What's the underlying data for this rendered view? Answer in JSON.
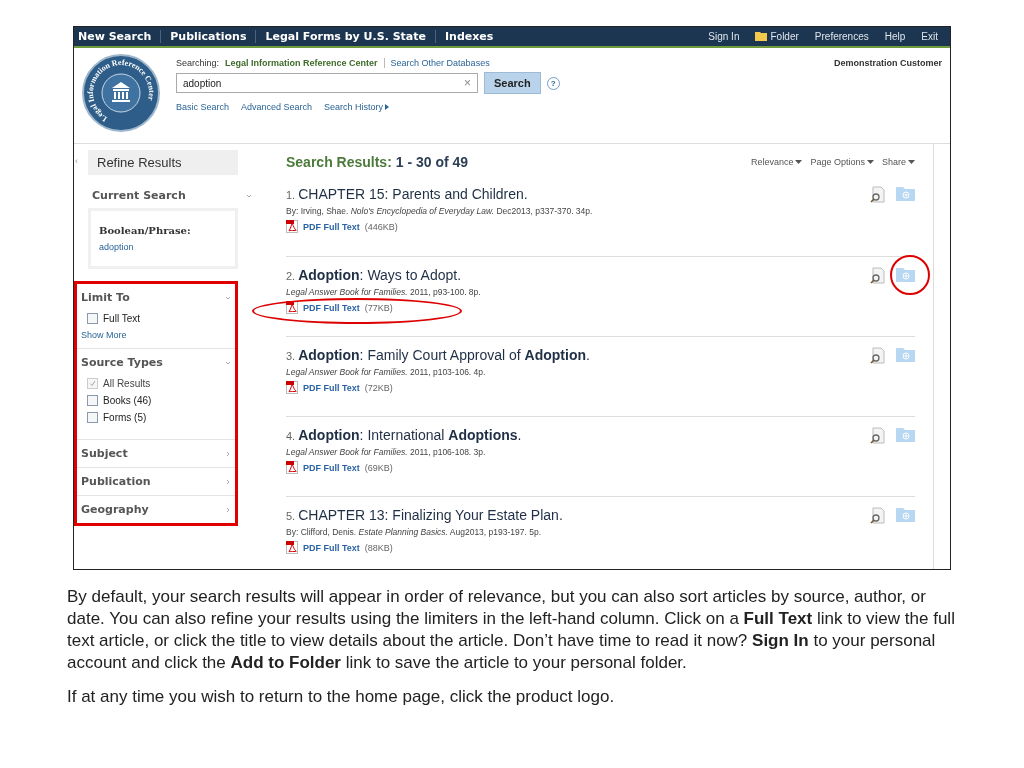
{
  "nav": {
    "left": [
      "New Search",
      "Publications",
      "Legal Forms by U.S. State",
      "Indexes"
    ],
    "right": [
      {
        "label": "Sign In",
        "kind": "link"
      },
      {
        "label": "Folder",
        "kind": "folder"
      },
      {
        "label": "Preferences",
        "kind": "link"
      },
      {
        "label": "Help",
        "kind": "link"
      },
      {
        "label": "Exit",
        "kind": "link"
      }
    ]
  },
  "logo": {
    "text": "Legal Information Reference Center"
  },
  "header": {
    "searching_label": "Searching:",
    "database": "Legal Information Reference Center",
    "other": "Search Other Databases",
    "query": "adoption",
    "clear": "×",
    "search_button": "Search",
    "help": "?",
    "links": [
      "Basic Search",
      "Advanced Search",
      "Search History"
    ],
    "customer": "Demonstration Customer"
  },
  "sidebar": {
    "collapse": "‹",
    "title": "Refine Results",
    "current_search": {
      "title": "Current Search",
      "expanded": true,
      "label": "Boolean/Phrase:",
      "value": "adoption"
    },
    "highlighted": true,
    "sections": [
      {
        "title": "Limit To",
        "expanded": true,
        "options": [
          {
            "label": "Full Text",
            "checked": false,
            "disabled": false
          }
        ],
        "more": "Show More"
      },
      {
        "title": "Source Types",
        "expanded": true,
        "options": [
          {
            "label": "All Results",
            "checked": true,
            "disabled": true
          },
          {
            "label": "Books (46)",
            "checked": false,
            "disabled": false
          },
          {
            "label": "Forms (5)",
            "checked": false,
            "disabled": false
          }
        ]
      },
      {
        "title": "Subject",
        "expanded": false
      },
      {
        "title": "Publication",
        "expanded": false
      },
      {
        "title": "Geography",
        "expanded": false
      }
    ]
  },
  "results": {
    "heading_label": "Search Results:",
    "heading_range": "1 - 30 of 49",
    "tools": [
      "Relevance",
      "Page Options",
      "Share"
    ],
    "items": [
      {
        "number": "1.",
        "title": "CHAPTER 15: Parents and Children.",
        "source": "By: Irving, Shae. *Nolo's Encyclopedia of Everyday Law.* Dec2013, p337-370. 34p.",
        "link": "PDF Full Text",
        "size": "(446KB)",
        "link_circled": false,
        "folder_circled": false
      },
      {
        "number": "2.",
        "title": "**Adoption**: Ways to Adopt.",
        "source": "*Legal Answer Book for Families.* 2011, p93-100. 8p.",
        "link": "PDF Full Text",
        "size": "(77KB)",
        "link_circled": true,
        "folder_circled": true
      },
      {
        "number": "3.",
        "title": "**Adoption**: Family Court Approval of **Adoption**.",
        "source": "*Legal Answer Book for Families.* 2011, p103-106. 4p.",
        "link": "PDF Full Text",
        "size": "(72KB)",
        "link_circled": false,
        "folder_circled": false
      },
      {
        "number": "4.",
        "title": "**Adoption**: International **Adoptions**.",
        "source": "*Legal Answer Book for Families.* 2011, p106-108. 3p.",
        "link": "PDF Full Text",
        "size": "(69KB)",
        "link_circled": false,
        "folder_circled": false
      },
      {
        "number": "5.",
        "title": "CHAPTER 13: Finalizing Your Estate Plan.",
        "source": "By: Clifford, Denis. *Estate Planning Basics.* Aug2013, p193-197. 5p.",
        "link": "PDF Full Text",
        "size": "(88KB)",
        "link_circled": false,
        "folder_circled": false
      }
    ]
  },
  "caption": [
    "By default, your search results will appear in order of relevance, but you can also sort articles by source, author, or date. You can also refine your results using the limiters in the left-hand column. Click on a **Full Text** link to view the full text article, or click the title to view details about the article. Don’t have time to read it now? **Sign In** to your personal account and click the **Add to Folder** link to save the article to your personal folder.",
    "If at any time you wish to return to the home page, click the product logo."
  ]
}
